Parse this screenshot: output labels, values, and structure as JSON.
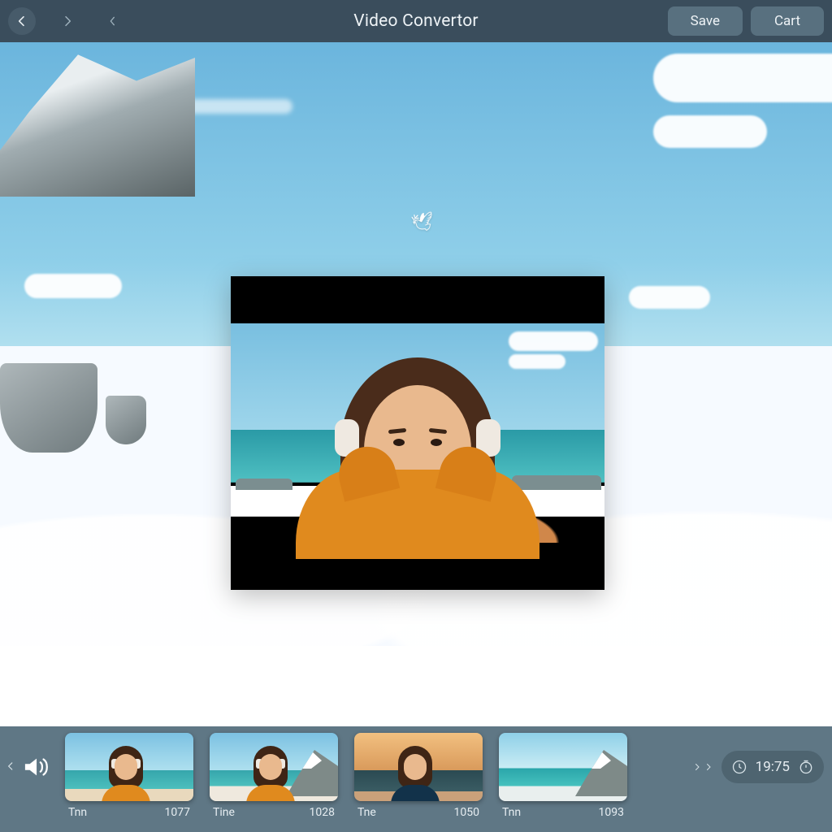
{
  "header": {
    "title": "Video Convertor",
    "save_label": "Save",
    "cart_label": "Cart"
  },
  "bird_glyph": "🕊",
  "footer": {
    "timecode": "19:75",
    "thumbs": [
      {
        "name": "Tnn",
        "code": "1077"
      },
      {
        "name": "Tine",
        "code": "1028"
      },
      {
        "name": "Tne",
        "code": "1050"
      },
      {
        "name": "Tnn",
        "code": "1093"
      }
    ]
  }
}
